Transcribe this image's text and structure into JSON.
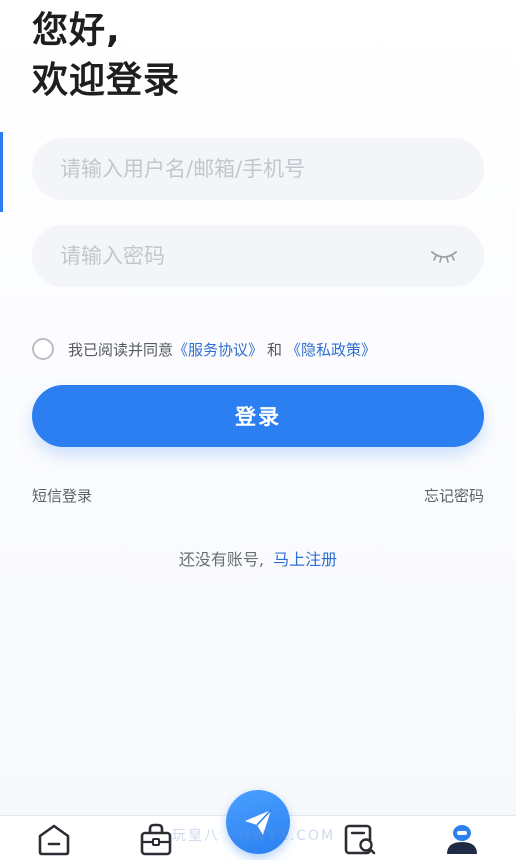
{
  "greeting": {
    "line1": "您好,",
    "line2": "欢迎登录"
  },
  "form": {
    "username_placeholder": "请输入用户名/邮箱/手机号",
    "username_value": "",
    "password_placeholder": "请输入密码",
    "password_value": ""
  },
  "agreement": {
    "prefix": "我已阅读并同意",
    "service_link": "《服务协议》",
    "and_text": "和",
    "privacy_link": "《隐私政策》",
    "checked": false
  },
  "login_button_label": "登录",
  "links": {
    "sms_login": "短信登录",
    "forgot_password": "忘记密码"
  },
  "register": {
    "prompt": "还没有账号,",
    "link": "马上注册"
  },
  "watermark_text": "玩皇八 · NWYX.COM",
  "bottom_nav": {
    "items": [
      {
        "icon": "home-icon"
      },
      {
        "icon": "bag-icon"
      },
      {
        "icon": "send-icon"
      },
      {
        "icon": "search-list-icon"
      },
      {
        "icon": "profile-icon"
      }
    ]
  },
  "colors": {
    "accent": "#2b7ff1",
    "link": "#2f6fd1",
    "field_bg": "#f3f5f8"
  }
}
